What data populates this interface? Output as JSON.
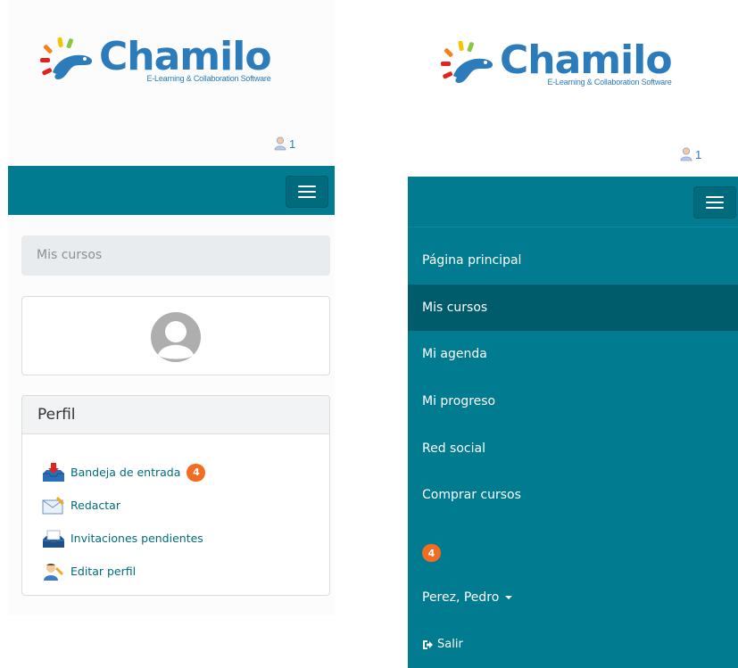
{
  "brand": {
    "name": "Chamilo",
    "tagline": "E-Learning & Collaboration Software",
    "color": "#2c7bbb"
  },
  "header": {
    "online_users_icon": "user-icon",
    "online_users_count": "1"
  },
  "navbar": {
    "color": "#007b8f",
    "toggle_icon": "hamburger-icon"
  },
  "left": {
    "my_courses_label": "Mis cursos",
    "avatar_icon": "default-avatar-icon",
    "profile": {
      "title": "Perfil",
      "items": [
        {
          "label": "Bandeja de entrada",
          "icon": "inbox-icon",
          "badge": "4"
        },
        {
          "label": "Redactar",
          "icon": "envelope-icon"
        },
        {
          "label": "Invitaciones pendientes",
          "icon": "invitation-tray-icon"
        },
        {
          "label": "Editar perfil",
          "icon": "edit-profile-icon"
        }
      ]
    }
  },
  "right": {
    "menu": [
      {
        "label": "Página principal",
        "active": false
      },
      {
        "label": "Mis cursos",
        "active": true
      },
      {
        "label": "Mi agenda",
        "active": false
      },
      {
        "label": "Mi progreso",
        "active": false
      },
      {
        "label": "Red social",
        "active": false
      },
      {
        "label": "Comprar cursos",
        "active": false
      }
    ],
    "notification_badge": "4",
    "user_name": "Perez, Pedro",
    "logout_label": "Salir",
    "logout_icon": "sign-out-icon"
  },
  "colors": {
    "badge": "#f26d21",
    "active_menu": "#005b6b",
    "link": "#006b7c"
  }
}
